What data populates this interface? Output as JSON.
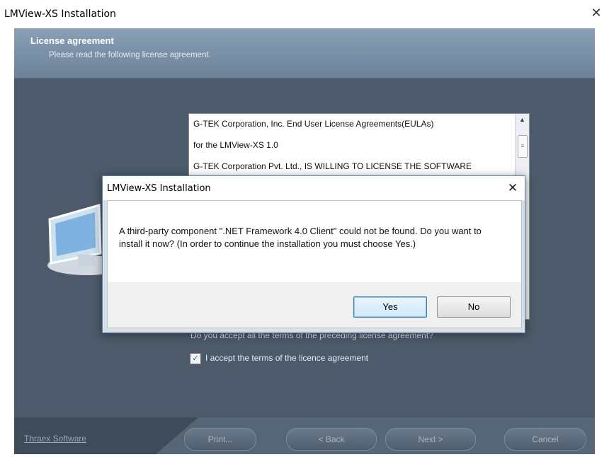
{
  "outer_window": {
    "title": "LMView-XS Installation",
    "close_glyph": "✕"
  },
  "header": {
    "title": "License agreement",
    "subtitle": "Please read the following license agreement."
  },
  "license": {
    "lines": [
      "G-TEK Corporation, Inc. End User License Agreements(EULAs)",
      "for the LMView-XS 1.0",
      "G-TEK Corporation Pvt. Ltd., IS WILLING TO LICENSE THE SOFTWARE"
    ]
  },
  "accept": {
    "question": "Do you accept all the terms of the preceding license agreement?",
    "checkbox_label": "I accept the terms of the licence agreement",
    "checked": true
  },
  "footer": {
    "brand": "Thraex Software",
    "buttons": {
      "print": "Print...",
      "back": "< Back",
      "next": "Next >",
      "cancel": "Cancel"
    }
  },
  "dialog": {
    "title": "LMView-XS Installation",
    "close_glyph": "✕",
    "message": "A third-party component \".NET Framework 4.0 Client\" could not be found. Do you want to install it now? (In order to continue the installation you must choose Yes.)",
    "yes_label": "Yes",
    "no_label": "No"
  },
  "icons": {
    "scroll_up": "▲",
    "scroll_down": "▼",
    "scroll_thumb": "≡",
    "checkmark": "✓"
  },
  "colors": {
    "client_bg": "#4c5a6b",
    "header_band": "#7a91a8",
    "dialog_accent": "#3c7fb1"
  }
}
